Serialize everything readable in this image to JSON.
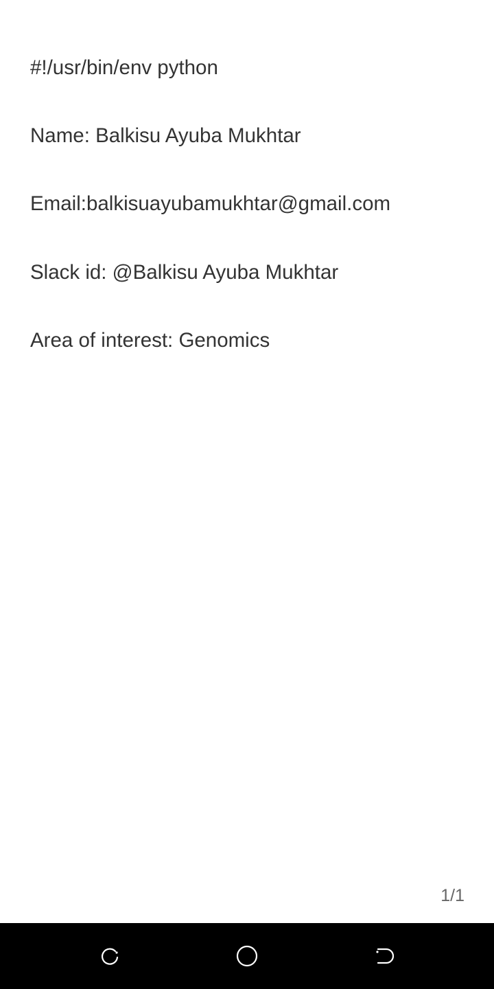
{
  "document": {
    "lines": [
      "#!/usr/bin/env python",
      "Name: Balkisu Ayuba Mukhtar",
      "Email:balkisuayubamukhtar@gmail.com",
      "Slack id: @Balkisu Ayuba Mukhtar",
      "Area of interest: Genomics"
    ],
    "page_indicator": "1/1"
  },
  "navbar": {
    "buttons": [
      {
        "icon": "recent-apps-icon"
      },
      {
        "icon": "home-icon"
      },
      {
        "icon": "back-icon"
      }
    ]
  }
}
